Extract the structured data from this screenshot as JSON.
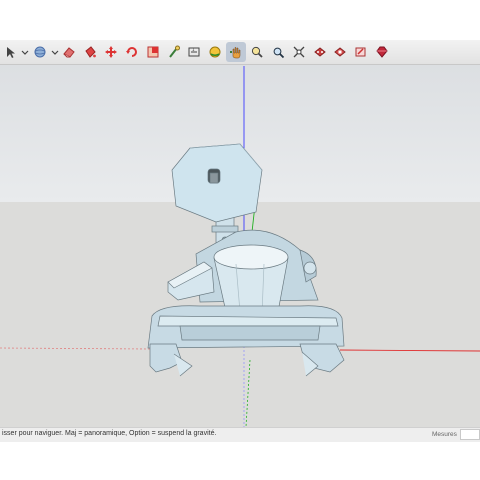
{
  "toolbar": {
    "tools": [
      {
        "icon": "select-arrow-icon",
        "color": "#444444"
      },
      {
        "icon": "dropdown-chevron-icon",
        "color": "#444444"
      },
      {
        "icon": "orbit-sphere-icon",
        "color": "#4b6ea8"
      },
      {
        "icon": "dropdown-chevron-icon",
        "color": "#444444"
      },
      {
        "icon": "eraser-icon",
        "color": "#c0392b"
      },
      {
        "icon": "paint-bucket-icon",
        "color": "#c0392b"
      },
      {
        "icon": "move-icon",
        "color": "#c0392b"
      },
      {
        "icon": "rotate-icon",
        "color": "#c0392b"
      },
      {
        "icon": "scale-icon",
        "color": "#c0392b"
      },
      {
        "icon": "tape-measure-icon",
        "color": "#3a7d3a"
      },
      {
        "icon": "dimension-icon",
        "color": "#444444"
      },
      {
        "icon": "orbit-icon",
        "color": "#d4a017"
      },
      {
        "icon": "pan-hand-icon",
        "color": "#3a7d3a"
      },
      {
        "icon": "zoom-icon",
        "color": "#444444"
      },
      {
        "icon": "zoom-window-icon",
        "color": "#444444"
      },
      {
        "icon": "zoom-extents-icon",
        "color": "#444444"
      },
      {
        "icon": "warehouse-icon",
        "color": "#c0392b"
      },
      {
        "icon": "extension-warehouse-icon",
        "color": "#c0392b"
      },
      {
        "icon": "layout-icon",
        "color": "#c0392b"
      },
      {
        "icon": "ruby-icon",
        "color": "#c0392b"
      }
    ],
    "active_index": 12
  },
  "statusbar": {
    "hint": "isser pour naviguer. Maj = panoramique, Option =  suspend la gravité.",
    "measure_label": "Mesures",
    "measure_value": ""
  },
  "colors": {
    "sky": "#e2e5e8",
    "ground": "#dcdcda",
    "model": "#cfe1ea",
    "axis_blue": "#3a3aff",
    "axis_red": "#e03030",
    "axis_green": "#20b020"
  }
}
